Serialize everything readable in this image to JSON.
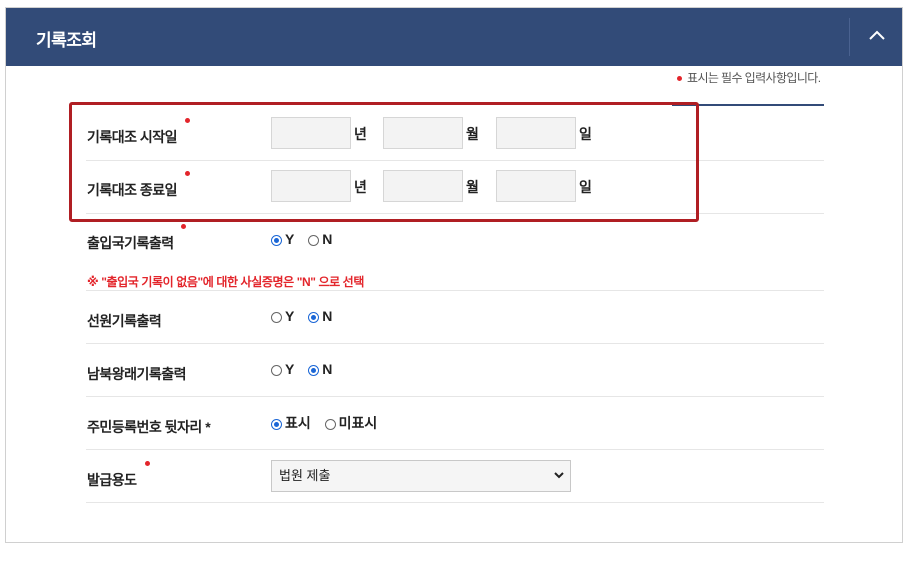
{
  "header": {
    "title": "기록조회",
    "toggle_icon": "chevron-up-icon"
  },
  "legend": {
    "text": "표시는 필수 입력사항입니다."
  },
  "colors": {
    "header_bg": "#324b78",
    "required_dot": "#e3252b",
    "highlight_border": "#b01e23",
    "radio_checked": "#1a66d6"
  },
  "start_date": {
    "label": "기록대조 시작일",
    "year_unit": "년",
    "month_unit": "월",
    "day_unit": "일",
    "year": "",
    "month": "",
    "day": ""
  },
  "end_date": {
    "label": "기록대조 종료일",
    "year_unit": "년",
    "month_unit": "월",
    "day_unit": "일",
    "year": "",
    "month": "",
    "day": ""
  },
  "immigration": {
    "label": "출입국기록출력",
    "options": [
      "Y",
      "N"
    ],
    "selected": "Y",
    "notice": "※ \"출입국 기록이 없음\"에 대한 사실증명은 \"N\" 으로 선택"
  },
  "seafarer": {
    "label": "선원기록출력",
    "options": [
      "Y",
      "N"
    ],
    "selected": "N"
  },
  "interkorean": {
    "label": "남북왕래기록출력",
    "options": [
      "Y",
      "N"
    ],
    "selected": "N"
  },
  "resident_number": {
    "label": "주민등록번호 뒷자리 *",
    "options": [
      "표시",
      "미표시"
    ],
    "selected": "표시"
  },
  "purpose": {
    "label": "발급용도",
    "selected": "법원 제출"
  }
}
